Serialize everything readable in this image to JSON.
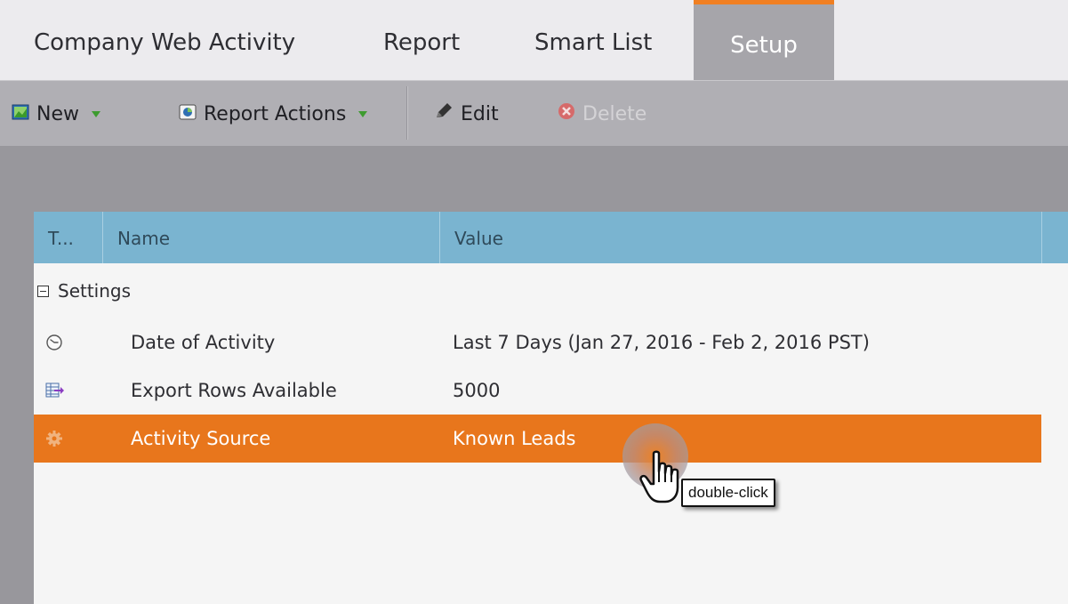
{
  "tabs": [
    {
      "label": "Company Web Activity",
      "active": false
    },
    {
      "label": "Report",
      "active": false
    },
    {
      "label": "Smart List",
      "active": false
    },
    {
      "label": "Setup",
      "active": true
    }
  ],
  "toolbar": {
    "new_label": "New",
    "report_actions_label": "Report Actions",
    "edit_label": "Edit",
    "delete_label": "Delete"
  },
  "grid": {
    "columns": [
      "T...",
      "Name",
      "Value"
    ],
    "group_label": "Settings",
    "rows": [
      {
        "icon": "clock-icon",
        "name": "Date of Activity",
        "value": "Last 7 Days (Jan 27, 2016 - Feb 2, 2016 PST)",
        "selected": false
      },
      {
        "icon": "export-rows-icon",
        "name": "Export Rows Available",
        "value": "5000",
        "selected": false
      },
      {
        "icon": "gear-icon",
        "name": "Activity Source",
        "value": "Known Leads",
        "selected": true
      }
    ]
  },
  "cursor": {
    "tooltip": "double-click"
  },
  "colors": {
    "accent": "#f07f22",
    "selected_row": "#e8761c",
    "grid_header": "#7ab4d0"
  }
}
